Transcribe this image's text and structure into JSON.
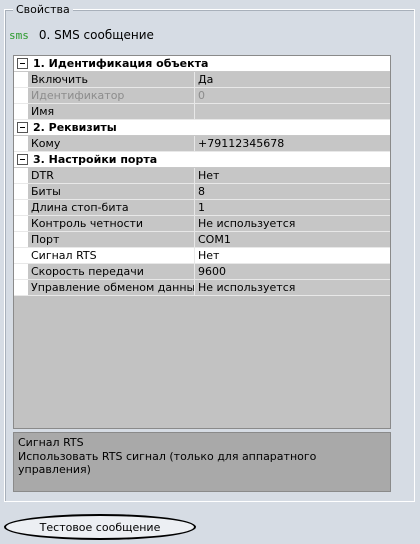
{
  "panel": {
    "title": "Свойства",
    "object_icon": "sms-icon",
    "object_icon_text": "sms",
    "object_title": "0. SMS сообщение"
  },
  "categories": [
    {
      "label": "1. Идентификация объекта",
      "properties": [
        {
          "name": "Включить",
          "value": "Да",
          "disabled": false
        },
        {
          "name": "Идентификатор",
          "value": "0",
          "disabled": true
        },
        {
          "name": "Имя",
          "value": "",
          "disabled": false
        }
      ]
    },
    {
      "label": "2. Реквизиты",
      "properties": [
        {
          "name": "Кому",
          "value": "+79112345678",
          "disabled": false
        }
      ]
    },
    {
      "label": "3. Настройки порта",
      "properties": [
        {
          "name": "DTR",
          "value": "Нет",
          "disabled": false
        },
        {
          "name": "Биты",
          "value": "8",
          "disabled": false
        },
        {
          "name": "Длина стоп-бита",
          "value": "1",
          "disabled": false
        },
        {
          "name": "Контроль четности",
          "value": "Не используется",
          "disabled": false
        },
        {
          "name": "Порт",
          "value": "COM1",
          "disabled": false
        },
        {
          "name": "Сигнал RTS",
          "value": "Нет",
          "disabled": false,
          "selected": true
        },
        {
          "name": "Скорость передачи",
          "value": "9600",
          "disabled": false
        },
        {
          "name": "Управление обменом данными",
          "value": "Не используется",
          "disabled": false
        }
      ]
    }
  ],
  "description": {
    "title": "Сигнал RTS",
    "text": "Использовать RTS сигнал (только для аппаратного управления)"
  },
  "buttons": {
    "test_message": "Тестовое сообщение"
  },
  "colors": {
    "icon_green": "#2a9a2a",
    "grid_bg": "#c6c6c6",
    "description_bg": "#a9a9a9"
  }
}
